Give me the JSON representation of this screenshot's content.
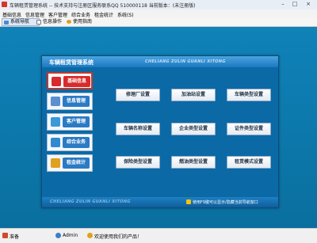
{
  "window": {
    "title": "车辆租赁管理系统 -- 技术支持与注册区服务联系QQ 510000118     当前版本：(未注册版)",
    "min": "–",
    "max": "□",
    "close": "×"
  },
  "menu": [
    "基础信息",
    "信息管理",
    "客户管理",
    "综合业务",
    "租金统计",
    "系统(S)"
  ],
  "toolbar": {
    "nav": "系统导航",
    "info": "信息操作",
    "help": "使用指南"
  },
  "panel": {
    "title": "车辆租赁管理系统",
    "subtitle_en": "CHELIANG ZULIN GUANLI XITONG",
    "footer_en": "CHELIANG ZULIN GUANLI XITONG",
    "hint": "使用F9键可以显示/隐藏当前导航窗口"
  },
  "sidebar": [
    {
      "label": "基础信息",
      "color": "#d92b2b"
    },
    {
      "label": "信息管理",
      "color": "#2b7bc4"
    },
    {
      "label": "客户管理",
      "color": "#2b7bc4"
    },
    {
      "label": "综合业务",
      "color": "#2b7bc4"
    },
    {
      "label": "租金统计",
      "color": "#2b7bc4"
    }
  ],
  "buttons": [
    "修理厂设置",
    "加油站设置",
    "车辆类型设置",
    "车辆名称设置",
    "企业类型设置",
    "证件类型设置",
    "保险类型设置",
    "燃油类型设置",
    "租赁模式设置"
  ],
  "status": {
    "ready": "准备",
    "user": "Admin",
    "welcome": "欢迎使用我们的产品！"
  }
}
